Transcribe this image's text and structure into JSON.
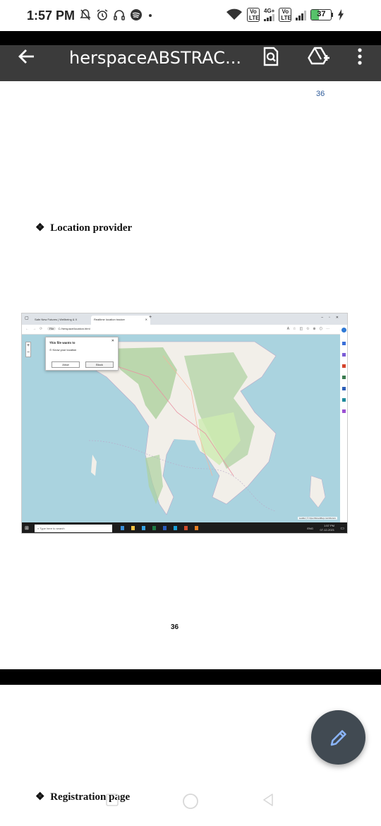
{
  "status_bar": {
    "time": "1:57 PM",
    "network_label": "4G+",
    "volte_label_1": "Vo LTE",
    "volte_label_2": "Vo LTE",
    "battery_level": "37",
    "battery_fraction": 0.37,
    "icons": [
      "mute-icon",
      "alarm-icon",
      "headset-icon",
      "spotify-icon",
      "dot-icon",
      "wifi-icon",
      "signal-icon",
      "battery-icon",
      "charging-icon"
    ]
  },
  "app_bar": {
    "title": "herspaceABSTRAC...",
    "icons": [
      "back-arrow-icon",
      "search-document-icon",
      "add-to-drive-icon",
      "more-vert-icon"
    ]
  },
  "document": {
    "page_number_top": "36",
    "heading_location": "Location provider",
    "bullet_symbol": "❖",
    "page_number_bottom": "36",
    "heading_registration": "Registration page",
    "embedded_screenshot": {
      "tab_1": "Safe New Futures | Wellbeing & X",
      "tab_2": "Realtime location tracker",
      "url_chip": "File",
      "url": "C:/herspace/location.html",
      "popup_title": "This file wants to",
      "popup_permission": "Know your location",
      "popup_allow": "Allow",
      "popup_block": "Block",
      "map_attribution": "Leaflet | © OpenStreetMap contributors",
      "taskbar_search": "Type here to search",
      "taskbar_lang": "ENG",
      "taskbar_time": "1:57 PM",
      "taskbar_date": "07-12-2021"
    }
  },
  "colors": {
    "app_bar_bg": "#3b3b3b",
    "fab_bg": "#414a52",
    "fab_icon": "#8ab4f8",
    "page_number_blue": "#2e5b9a",
    "battery_green": "#56c26a",
    "map_sea": "#aad3df",
    "map_land": "#f2efe9",
    "map_forest": "#add19e"
  }
}
